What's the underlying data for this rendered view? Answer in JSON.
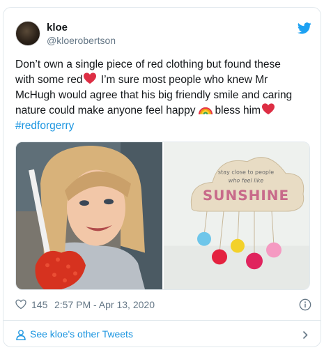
{
  "user": {
    "display_name": "kloe",
    "handle": "@kloerobertson"
  },
  "tweet": {
    "line1": "Don’t own a single piece of red clothing but found these",
    "line2_a": "with some red",
    "line2_b": " I’m sure most people who knew Mr",
    "line3": "McHugh would agree that his big friendly smile and caring",
    "line4_a": "nature could make anyone feel happy",
    "line4_b": "bless him",
    "hashtag": "#redforgerry"
  },
  "media": {
    "sign_line1": "stay close to people",
    "sign_line2": "who feel like",
    "sign_word": "SUNSHINE"
  },
  "meta": {
    "like_count": "145",
    "timestamp": "2:57 PM - Apr 13, 2020"
  },
  "footer": {
    "label": "See kloe's other Tweets"
  },
  "colors": {
    "link": "#1b95e0",
    "muted": "#657786",
    "border": "#e1e8ed",
    "heart": "#e0245e"
  },
  "icons": [
    "twitter-bird-icon",
    "red-heart-emoji",
    "rainbow-emoji",
    "like-heart-icon",
    "info-icon",
    "person-icon",
    "chevron-right-icon"
  ]
}
